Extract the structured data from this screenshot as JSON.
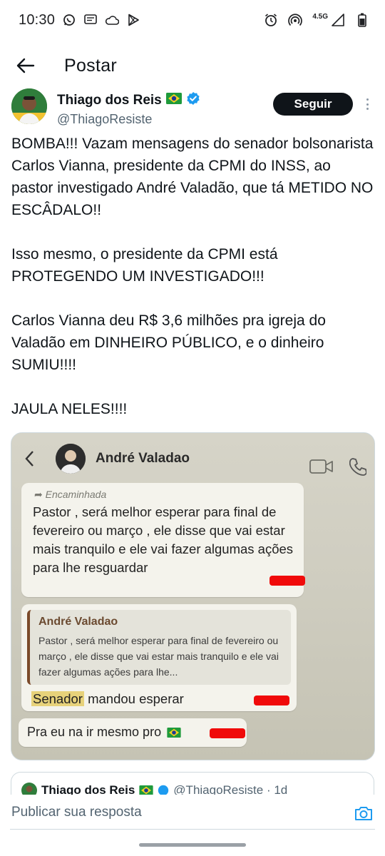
{
  "status_bar": {
    "time": "10:30",
    "network": "4.5G"
  },
  "header": {
    "title": "Postar"
  },
  "author": {
    "name": "Thiago dos Reis",
    "handle": "@ThiagoResiste",
    "verified": true,
    "follow_label": "Seguir"
  },
  "tweet": {
    "paragraphs": [
      "BOMBA!!! Vazam mensagens do senador bolsonarista Carlos Vianna, presidente da CPMI do INSS, ao pastor investigado André Valadão, que tá METIDO NO ESCÂDALO!!",
      "Isso mesmo, o presidente da CPMI está PROTEGENDO UM INVESTIGADO!!!",
      "Carlos Vianna deu R$ 3,6 milhões pra igreja do Valadão em DINHEIRO PÚBLICO, e o dinheiro SUMIU!!!!",
      "JAULA NELES!!!!"
    ]
  },
  "media": {
    "chat_name": "André Valadao",
    "forwarded_label": "Encaminhada",
    "message1": "Pastor , será melhor  esperar para final de fevereiro ou março , ele disse que vai estar mais tranquilo e ele vai fazer algumas ações para lhe resguardar",
    "quote_author": "André Valadao",
    "quote_text": "Pastor , será melhor  esperar para final de fevereiro ou março , ele disse que vai estar mais tranquilo e ele vai fazer algumas ações para lhe...",
    "reply_highlight": "Senador",
    "reply_rest": " mandou esperar",
    "message3": "Pra eu na ir mesmo pro"
  },
  "replies_peek": {
    "name": "Thiago dos Reis",
    "handle": "@ThiagoResiste · 1d"
  },
  "reply_bar": {
    "placeholder": "Publicar sua resposta"
  },
  "colors": {
    "text": "#0f1419",
    "secondary": "#536471",
    "verified": "#1d9bf0",
    "camera": "#1d9bf0"
  },
  "icons": [
    "whatsapp-icon",
    "message-icon",
    "cloud-icon",
    "play-store-icon",
    "alarm-icon",
    "hotspot-icon",
    "signal-icon",
    "battery-icon",
    "back-arrow-icon",
    "verified-badge-icon",
    "brazil-flag-icon",
    "more-vertical-icon",
    "camera-icon"
  ]
}
